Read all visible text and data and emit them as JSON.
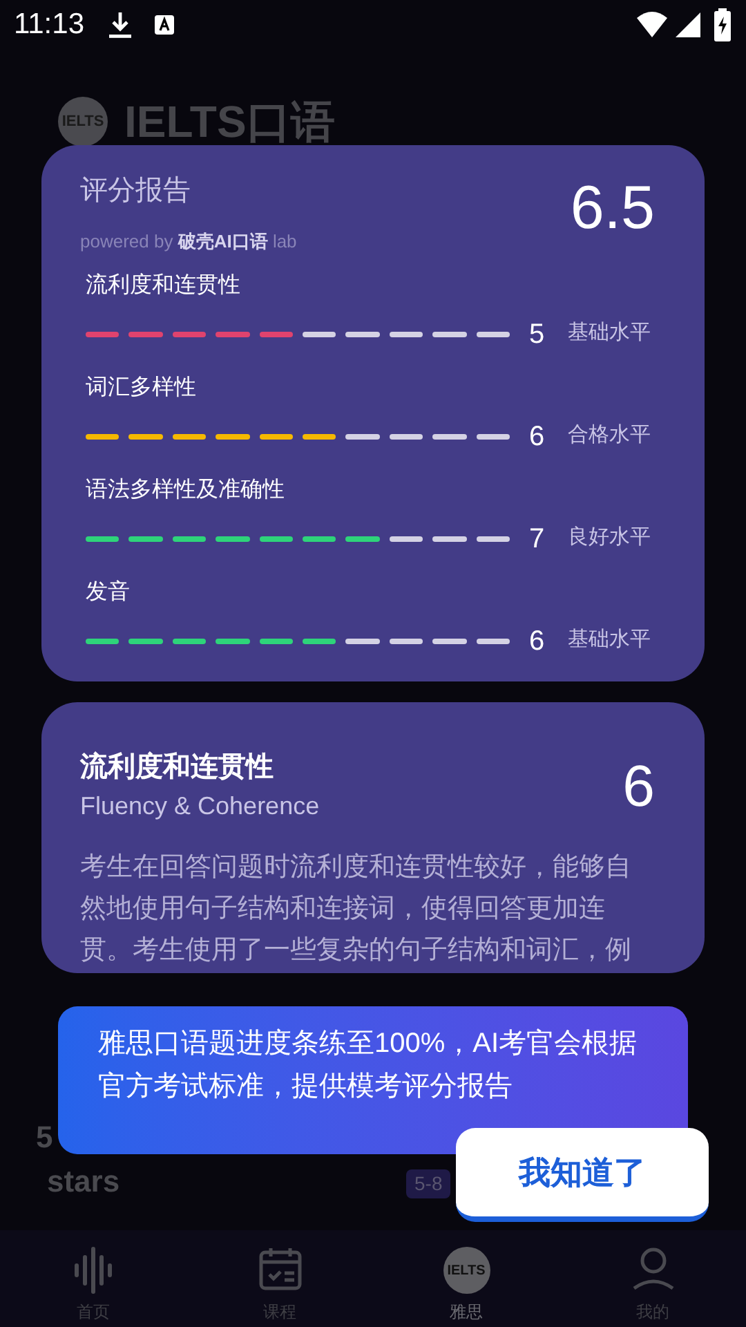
{
  "status_bar": {
    "time": "11:13"
  },
  "header": {
    "logo": "IELTS",
    "title": "IELTS口语"
  },
  "background_cards": [
    {
      "text": "5"
    },
    {
      "text": "stars"
    },
    {
      "text": "5-8"
    }
  ],
  "report": {
    "title": "评分报告",
    "powered_prefix": "powered by",
    "powered_brand": "破壳AI口语",
    "powered_suffix": "lab",
    "overall": "6.5",
    "criteria": [
      {
        "name": "流利度和连贯性",
        "level": 0.5,
        "color": "#e0436e",
        "score": "5",
        "band": "基础水平"
      },
      {
        "name": "词汇多样性",
        "level": 0.6,
        "color": "#f5b800",
        "score": "6",
        "band": "合格水平"
      },
      {
        "name": "语法多样性及准确性",
        "level": 0.7,
        "color": "#2ed47a",
        "score": "7",
        "band": "良好水平"
      },
      {
        "name": "发音",
        "level": 0.6,
        "color": "#2ed47a",
        "score": "6",
        "band": "基础水平"
      }
    ]
  },
  "detail": {
    "title": "流利度和连贯性",
    "subtitle": "Fluency & Coherence",
    "score": "6",
    "text": "考生在回答问题时流利度和连贯性较好，能够自然地使用句子结构和连接词，使得回答更加连贯。考生使用了一些复杂的句子结构和词汇，例"
  },
  "tip": {
    "text": "雅思口语题进度条练至100%，AI考官会根据官方考试标准，提供模考评分报告",
    "button": "我知道了"
  },
  "nav": [
    {
      "label": "首页",
      "kind": "wave",
      "selected": false
    },
    {
      "label": "课程",
      "kind": "calendar",
      "selected": false
    },
    {
      "label": "雅思",
      "kind": "badge",
      "badge": "IELTS",
      "selected": true
    },
    {
      "label": "我的",
      "kind": "person",
      "selected": false
    }
  ]
}
